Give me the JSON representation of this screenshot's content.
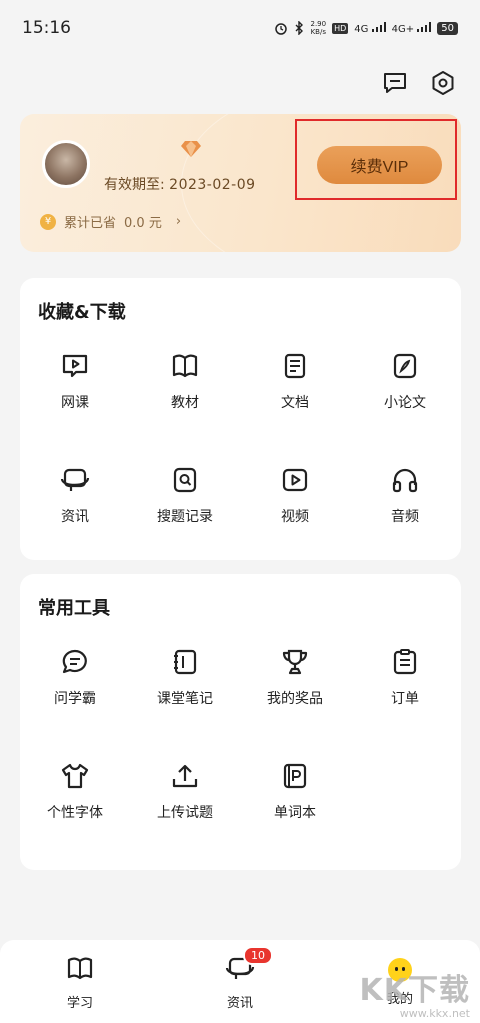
{
  "status_bar": {
    "time": "15:16",
    "net_speed_value": "2.90",
    "net_speed_unit": "KB/s",
    "hd_label": "HD",
    "sim1": "4G",
    "sim2": "4G+",
    "battery": "50"
  },
  "header_icons": [
    "message-icon",
    "settings-icon"
  ],
  "vip": {
    "expiry_label": "有效期至:",
    "expiry_date": "2023-02-09",
    "renew_label": "续费VIP",
    "savings_label": "累计已省",
    "savings_amount": "0.0 元",
    "coin_symbol": "¥"
  },
  "favorites": {
    "title": "收藏&下载",
    "items": [
      {
        "label": "网课",
        "icon": "video-course-icon"
      },
      {
        "label": "教材",
        "icon": "book-icon"
      },
      {
        "label": "文档",
        "icon": "document-icon"
      },
      {
        "label": "小论文",
        "icon": "pen-icon"
      },
      {
        "label": "资讯",
        "icon": "news-icon"
      },
      {
        "label": "搜题记录",
        "icon": "search-record-icon"
      },
      {
        "label": "视频",
        "icon": "video-icon"
      },
      {
        "label": "音频",
        "icon": "headphones-icon"
      }
    ]
  },
  "tools": {
    "title": "常用工具",
    "items": [
      {
        "label": "问学霸",
        "icon": "chat-icon"
      },
      {
        "label": "课堂笔记",
        "icon": "notebook-icon"
      },
      {
        "label": "我的奖品",
        "icon": "trophy-icon"
      },
      {
        "label": "订单",
        "icon": "clipboard-icon"
      },
      {
        "label": "个性字体",
        "icon": "tshirt-icon"
      },
      {
        "label": "上传试题",
        "icon": "upload-icon"
      },
      {
        "label": "单词本",
        "icon": "wordbook-icon"
      }
    ]
  },
  "bottom_nav": {
    "items": [
      {
        "label": "学习",
        "icon": "book-open-icon"
      },
      {
        "label": "资讯",
        "icon": "news-icon",
        "badge": "10"
      },
      {
        "label": "我的",
        "icon": "avatar-icon"
      }
    ]
  },
  "watermark": {
    "big": "KK下载",
    "small": "www.kkx.net"
  },
  "colors": {
    "accent": "#df8a3e",
    "highlight_box": "#e02a2a",
    "badge": "#e8352e"
  }
}
